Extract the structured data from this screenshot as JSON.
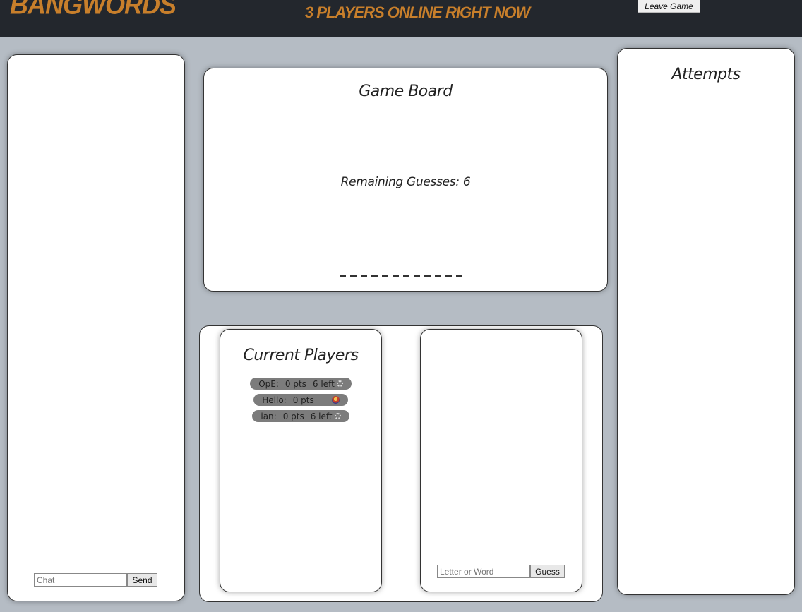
{
  "header": {
    "logo": "BANGWORDS",
    "online_status": "3 PLAYERS ONLINE RIGHT NOW",
    "leave_button": "Leave Game"
  },
  "chat": {
    "input_placeholder": "Chat",
    "send_label": "Send"
  },
  "board": {
    "title": "Game Board",
    "remaining_label": "Remaining Guesses: 6",
    "blank_count": 12
  },
  "players": {
    "title": "Current Players",
    "list": [
      {
        "name": "OpE:",
        "points": "0 pts",
        "left": "6 left",
        "status_icon": "loading-spinner-icon"
      },
      {
        "name": "Hello:",
        "points": "0 pts",
        "left": "",
        "status_icon": "hangman-avatar-icon"
      },
      {
        "name": "ian:",
        "points": "0 pts",
        "left": "6 left",
        "status_icon": "loading-spinner-icon"
      }
    ]
  },
  "guess": {
    "input_placeholder": "Letter or Word",
    "guess_label": "Guess"
  },
  "attempts": {
    "title": "Attempts"
  }
}
